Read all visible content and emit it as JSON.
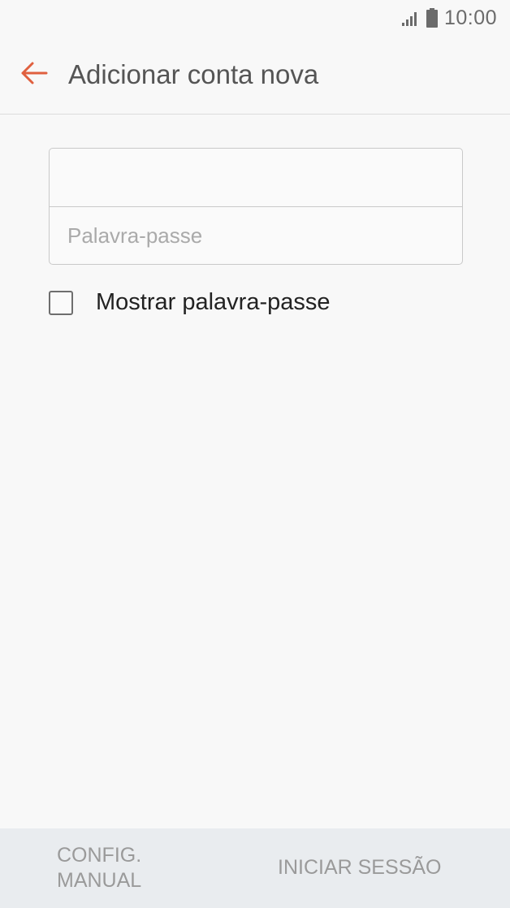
{
  "status_bar": {
    "time": "10:00",
    "signal_icon": "signal-icon",
    "battery_icon": "battery-icon"
  },
  "app_bar": {
    "back_icon": "arrow-left-icon",
    "title": "Adicionar conta nova",
    "accent_color": "#e0603f"
  },
  "form": {
    "email_value": "",
    "email_placeholder": "",
    "password_value": "",
    "password_placeholder": "Palavra-passe"
  },
  "show_password": {
    "label": "Mostrar palavra-passe",
    "checked": false
  },
  "bottom_bar": {
    "manual_line1": "CONFIG.",
    "manual_line2": "MANUAL",
    "login_label": "INICIAR SESSÃO"
  }
}
